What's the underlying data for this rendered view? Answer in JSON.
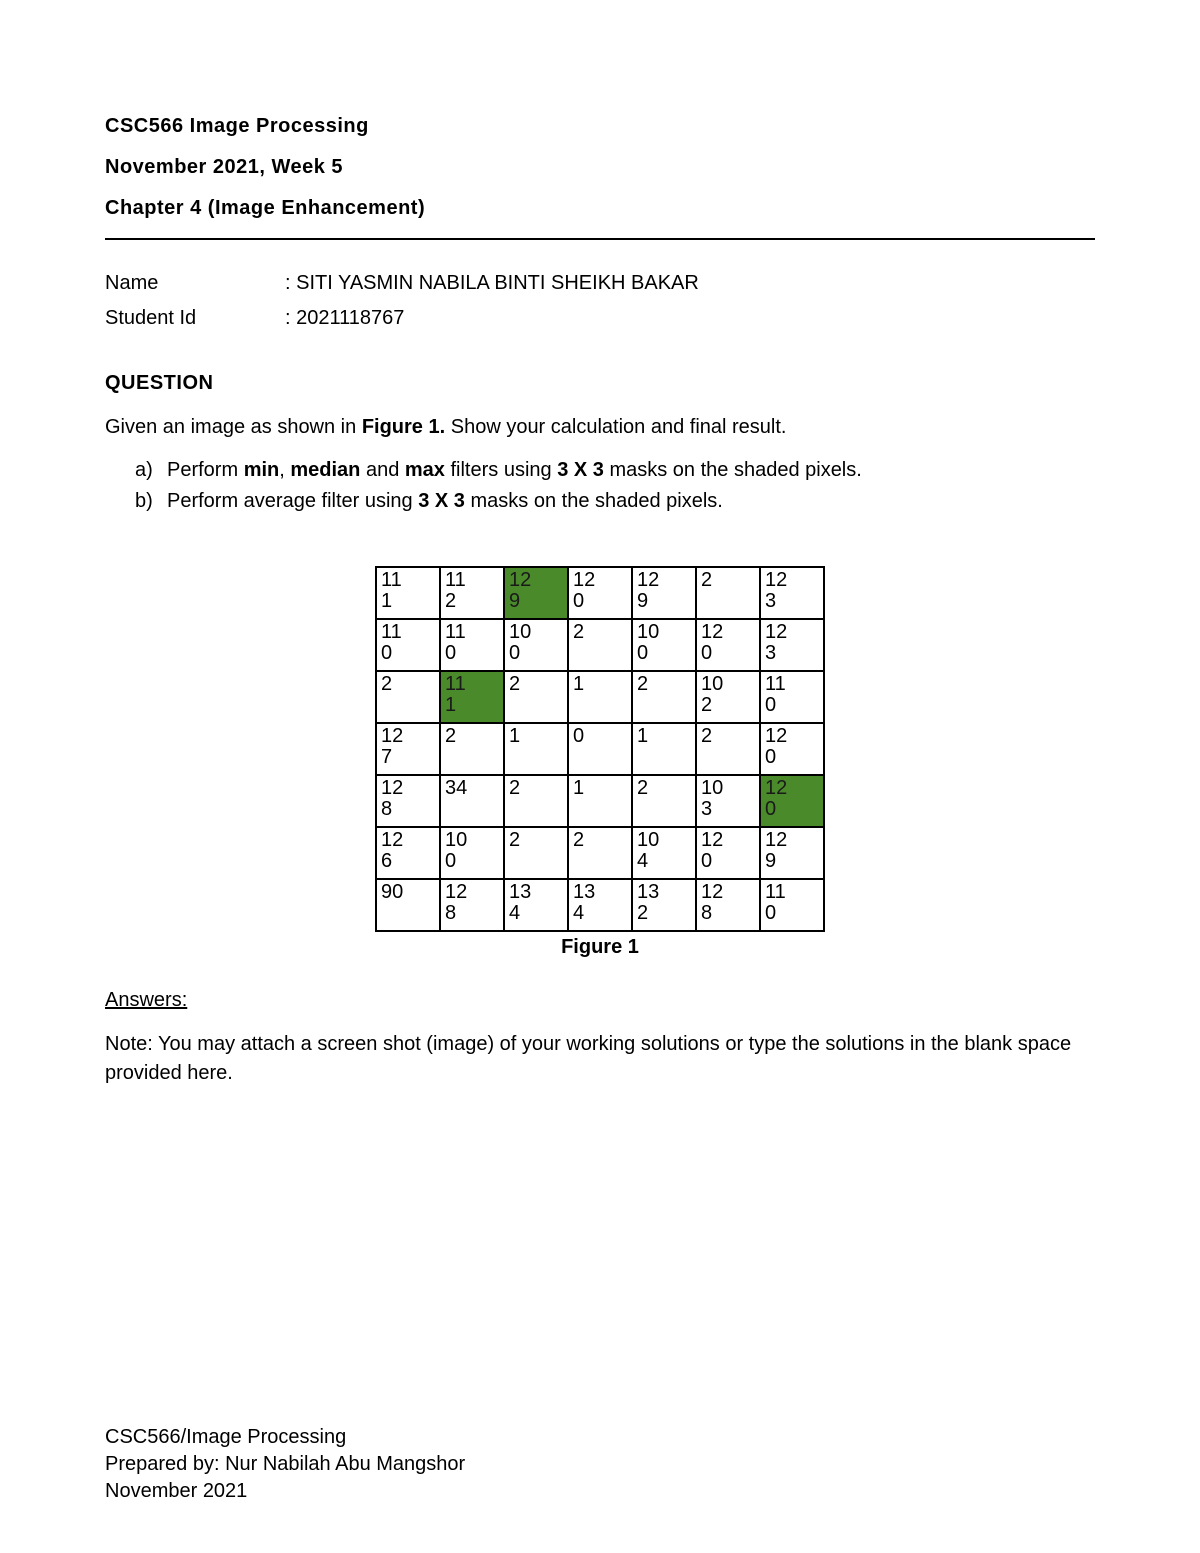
{
  "header": {
    "course": "CSC566 Image Processing",
    "week": "November 2021, Week 5",
    "chapter": "Chapter 4 (Image Enhancement)"
  },
  "student": {
    "name_label": "Name",
    "name_value": "SITI YASMIN NABILA BINTI SHEIKH BAKAR",
    "id_label": "Student Id",
    "id_value": "2021118767"
  },
  "question": {
    "title": "QUESTION",
    "intro_pre": "Given an image as shown in ",
    "intro_bold": "Figure 1.",
    "intro_post": " Show your calculation and final result.",
    "item_a_marker": "a)",
    "item_a_1": "Perform ",
    "item_a_b1": "min",
    "item_a_2": ", ",
    "item_a_b2": "median",
    "item_a_3": " and ",
    "item_a_b3": "max",
    "item_a_4": " filters using ",
    "item_a_b4": "3 X 3",
    "item_a_5": " masks on the shaded pixels.",
    "item_b_marker": "b)",
    "item_b_1": "Perform average filter using ",
    "item_b_b1": "3 X 3",
    "item_b_2": " masks on the shaded pixels."
  },
  "figure": {
    "caption": "Figure 1",
    "rows": [
      [
        {
          "v": "111"
        },
        {
          "v": "112"
        },
        {
          "v": "129",
          "s": true
        },
        {
          "v": "120"
        },
        {
          "v": "129"
        },
        {
          "v": "2"
        },
        {
          "v": "123"
        }
      ],
      [
        {
          "v": "110"
        },
        {
          "v": "110"
        },
        {
          "v": "100"
        },
        {
          "v": "2"
        },
        {
          "v": "100"
        },
        {
          "v": "120"
        },
        {
          "v": "123"
        }
      ],
      [
        {
          "v": "2"
        },
        {
          "v": "111",
          "s": true
        },
        {
          "v": "2"
        },
        {
          "v": "1"
        },
        {
          "v": "2"
        },
        {
          "v": "102"
        },
        {
          "v": "110"
        }
      ],
      [
        {
          "v": "127"
        },
        {
          "v": "2"
        },
        {
          "v": "1"
        },
        {
          "v": "0"
        },
        {
          "v": "1"
        },
        {
          "v": "2"
        },
        {
          "v": "120"
        }
      ],
      [
        {
          "v": "128"
        },
        {
          "v": "34"
        },
        {
          "v": "2"
        },
        {
          "v": "1"
        },
        {
          "v": "2"
        },
        {
          "v": "103"
        },
        {
          "v": "120",
          "s": true
        }
      ],
      [
        {
          "v": "126"
        },
        {
          "v": "100"
        },
        {
          "v": "2"
        },
        {
          "v": "2"
        },
        {
          "v": "104"
        },
        {
          "v": "120"
        },
        {
          "v": "129"
        }
      ],
      [
        {
          "v": "90"
        },
        {
          "v": "128"
        },
        {
          "v": "134"
        },
        {
          "v": "134"
        },
        {
          "v": "132"
        },
        {
          "v": "128"
        },
        {
          "v": "110"
        }
      ]
    ]
  },
  "answers": {
    "label": "Answers:",
    "note": "Note: You may attach a screen shot (image) of your working solutions or type the solutions in the blank space provided here."
  },
  "footer": {
    "l1": "CSC566/Image Processing",
    "l2": "Prepared by: Nur Nabilah Abu Mangshor",
    "l3": "November 2021"
  }
}
